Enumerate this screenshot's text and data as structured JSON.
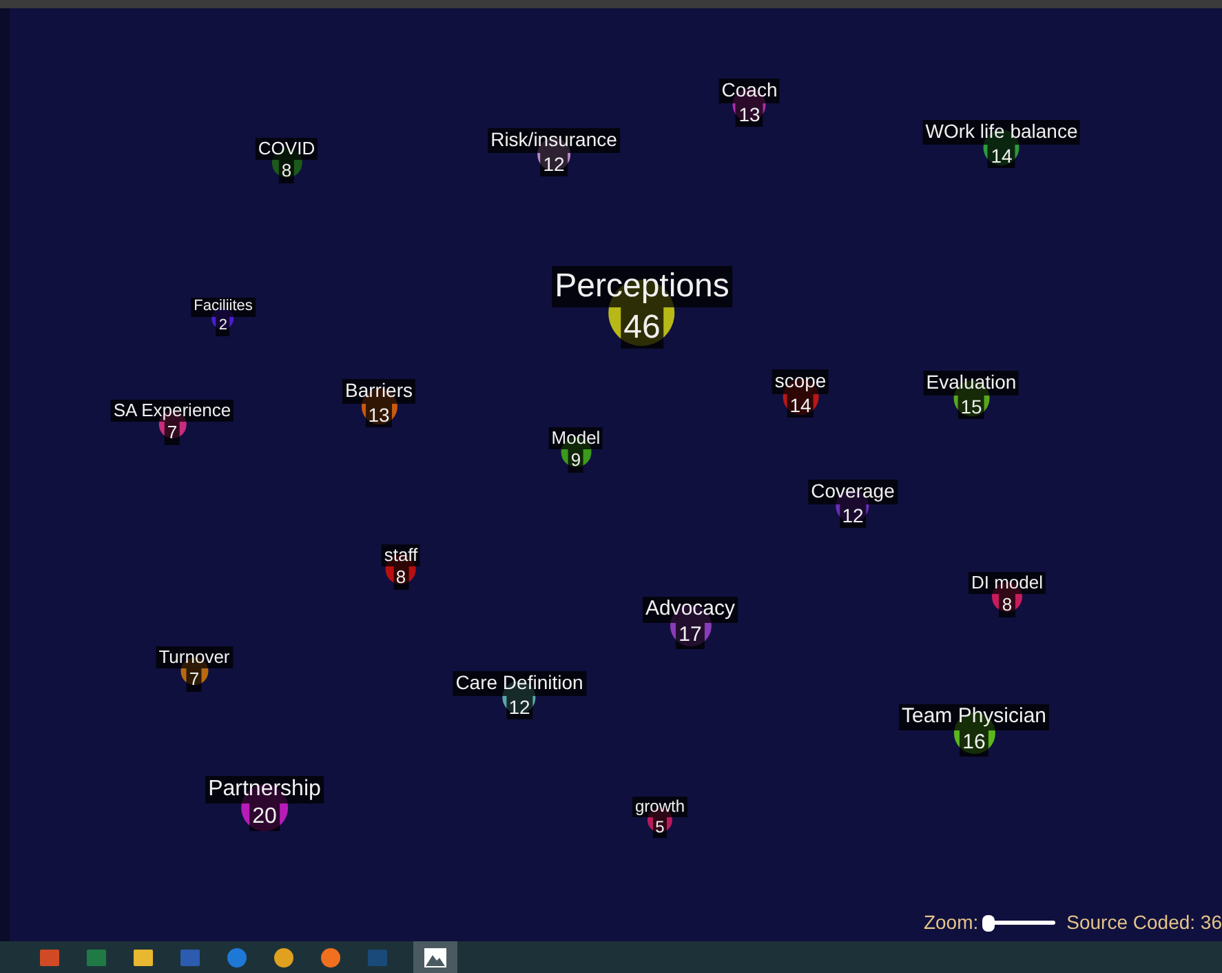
{
  "nodes": [
    {
      "label": "Coach",
      "count": "13",
      "color": "#b02ca8"
    },
    {
      "label": "COVID",
      "count": "8",
      "color": "#1c5a1c"
    },
    {
      "label": "Risk/insurance",
      "count": "12",
      "color": "#b888c8"
    },
    {
      "label": "WOrk life balance",
      "count": "14",
      "color": "#2e9a3c"
    },
    {
      "label": "Faciliites",
      "count": "2",
      "color": "#4a1ed0"
    },
    {
      "label": "Perceptions",
      "count": "46",
      "color": "#b8b818"
    },
    {
      "label": "SA Experience",
      "count": "7",
      "color": "#c82c7c"
    },
    {
      "label": "Barriers",
      "count": "13",
      "color": "#c85a10"
    },
    {
      "label": "scope",
      "count": "14",
      "color": "#b81818"
    },
    {
      "label": "Evaluation",
      "count": "15",
      "color": "#58a81c"
    },
    {
      "label": "Model",
      "count": "9",
      "color": "#3c9a1c"
    },
    {
      "label": "Coverage",
      "count": "12",
      "color": "#6a2cb8"
    },
    {
      "label": "staff",
      "count": "8",
      "color": "#b81010"
    },
    {
      "label": "DI model",
      "count": "8",
      "color": "#c81c5c"
    },
    {
      "label": "Advocacy",
      "count": "17",
      "color": "#8a3cb8"
    },
    {
      "label": "Turnover",
      "count": "7",
      "color": "#b86a10"
    },
    {
      "label": "Care Definition",
      "count": "12",
      "color": "#5aa8a8"
    },
    {
      "label": "Team Physician",
      "count": "16",
      "color": "#5ab81c"
    },
    {
      "label": "Partnership",
      "count": "20",
      "color": "#b81cb8"
    },
    {
      "label": "growth",
      "count": "5",
      "color": "#b81c5c"
    }
  ],
  "zoom": {
    "label": "Zoom:",
    "level": 0.05
  },
  "status": "Source Coded: 36"
}
